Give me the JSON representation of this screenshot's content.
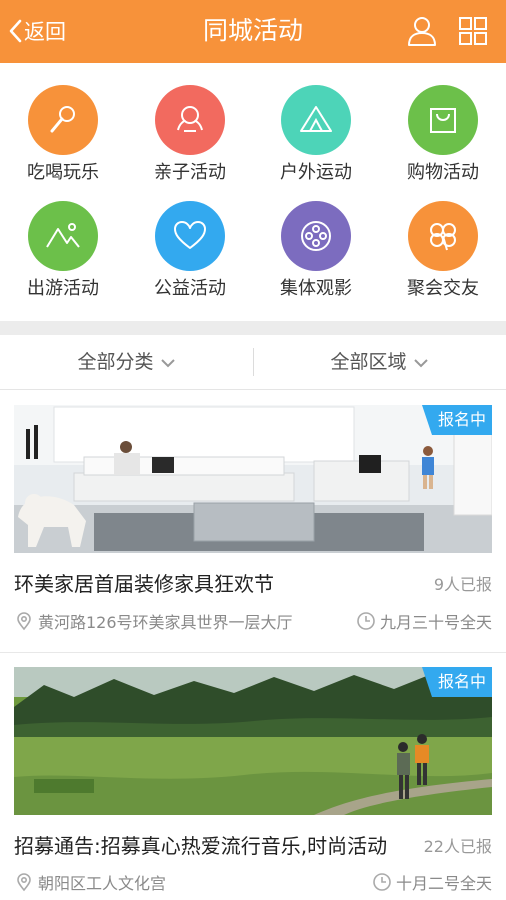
{
  "header": {
    "back_label": "返回",
    "title": "同城活动",
    "user_icon": "user-icon",
    "grid_icon": "grid-icon",
    "bg_color": "#f7923a"
  },
  "categories": [
    {
      "label": "吃喝玩乐",
      "icon": "microphone-icon",
      "color": "#f7923a"
    },
    {
      "label": "亲子活动",
      "icon": "family-icon",
      "color": "#f26a5f"
    },
    {
      "label": "户外运动",
      "icon": "tent-icon",
      "color": "#4dd4b8"
    },
    {
      "label": "购物活动",
      "icon": "shopping-bag-icon",
      "color": "#6cc04a"
    },
    {
      "label": "出游活动",
      "icon": "mountain-icon",
      "color": "#6cc04a"
    },
    {
      "label": "公益活动",
      "icon": "heart-icon",
      "color": "#33a9ef"
    },
    {
      "label": "集体观影",
      "icon": "film-reel-icon",
      "color": "#7c6cbf"
    },
    {
      "label": "聚会交友",
      "icon": "clover-icon",
      "color": "#f7923a"
    }
  ],
  "filters": {
    "category": "全部分类",
    "region": "全部区域"
  },
  "events": [
    {
      "badge": "报名中",
      "title": "环美家居首届装修家具狂欢节",
      "count": "9人已报",
      "location": "黄河路126号环美家具世界一层大厅",
      "time": "九月三十号全天"
    },
    {
      "badge": "报名中",
      "title": "招募通告:招募真心热爱流行音乐,时尚活动",
      "count": "22人已报",
      "location": "朝阳区工人文化宫",
      "time": "十月二号全天"
    }
  ],
  "colors": {
    "badge": "#33a9ef",
    "separator": "#ececec"
  }
}
